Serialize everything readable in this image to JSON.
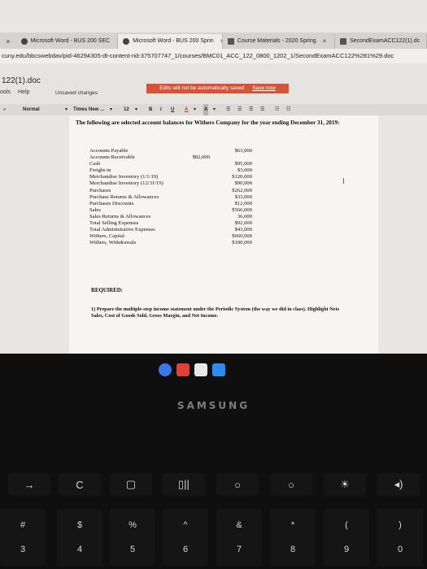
{
  "browser": {
    "tabs": [
      {
        "label": "Microsoft Word - BUS 200 SEC",
        "active": false
      },
      {
        "label": "Microsoft Word - BUS 200 Sprin",
        "active": true
      },
      {
        "label": "Course Materials - 2020 Spring",
        "active": false
      },
      {
        "label": "SecondExamACC122(1).dc",
        "active": false
      }
    ],
    "url": "cuny.edu/bbcswebdav/pid-46294305-dt-content-rid-375707747_1/courses/BMC01_ACC_122_0800_1202_1/SecondExamACC122%281%29.doc"
  },
  "app": {
    "doc_title": "122(1).doc",
    "menu_tools": "ools",
    "menu_help": "Help",
    "unsaved": "Unsaved changes",
    "banner_text": "Edits will not be automatically saved",
    "banner_link": "Save now"
  },
  "toolbar": {
    "style": "Normal",
    "font": "Times New ...",
    "size": "12",
    "bold": "B",
    "italic": "I",
    "underline": "U",
    "font_color": "A",
    "highlight": "A"
  },
  "document": {
    "heading": "The following are selected account balances for Withers Company for the year ending December 31, 2019:",
    "accounts": [
      {
        "name": "Accounts Payable",
        "amount": "$63,000",
        "col": "credit"
      },
      {
        "name": "Accounts Receivable",
        "amount": "$82,000",
        "col": "debit"
      },
      {
        "name": "Cash",
        "amount": "$95,000",
        "col": "credit"
      },
      {
        "name": "Freight-in",
        "amount": "$3,000",
        "col": "credit"
      },
      {
        "name": "Merchandise Inventory (1/1/19)",
        "amount": "$120,000",
        "col": "credit"
      },
      {
        "name": "Merchandise Inventory (12/31/19)",
        "amount": "$90,000",
        "col": "credit"
      },
      {
        "name": "Purchases",
        "amount": "$262,000",
        "col": "credit"
      },
      {
        "name": "Purchase Returns & Allowances",
        "amount": "$33,000",
        "col": "credit"
      },
      {
        "name": "Purchases Discounts",
        "amount": "$12,000",
        "col": "credit"
      },
      {
        "name": "Sales",
        "amount": "$566,000",
        "col": "credit"
      },
      {
        "name": "Sales Returns & Allowances",
        "amount": "36,000",
        "col": "credit"
      },
      {
        "name": "Total Selling Expenses",
        "amount": "$92,000",
        "col": "credit"
      },
      {
        "name": "Total Administrative Expenses",
        "amount": "$43,000",
        "col": "credit"
      },
      {
        "name": "Withers, Capital",
        "amount": "$660,000",
        "col": "credit"
      },
      {
        "name": "Withers, Withdrawals",
        "amount": "$100,000",
        "col": "credit"
      }
    ],
    "required_label": "REQUIRED:",
    "instruction": "1) Prepare the multiple-step income statement under the Periodic System (the way we did in class). Highlight Nets Sales, Cost of Goods Sold, Gross Margin, and Net Income."
  },
  "device": {
    "brand": "SAMSUNG"
  },
  "keyboard": {
    "fn_row": [
      "→",
      "C",
      "▢",
      "▯||",
      "○",
      "○",
      "☀",
      "◂)"
    ],
    "num_row": [
      {
        "top": "#",
        "bottom": "3"
      },
      {
        "top": "$",
        "bottom": "4"
      },
      {
        "top": "%",
        "bottom": "5"
      },
      {
        "top": "^",
        "bottom": "6"
      },
      {
        "top": "&",
        "bottom": "7"
      },
      {
        "top": "*",
        "bottom": "8"
      },
      {
        "top": "(",
        "bottom": "9"
      },
      {
        "top": ")",
        "bottom": "0"
      }
    ]
  },
  "colors": {
    "banner": "#d2553a",
    "screen_bg": "#e9e7e3",
    "page_bg": "#f6f5f2"
  }
}
